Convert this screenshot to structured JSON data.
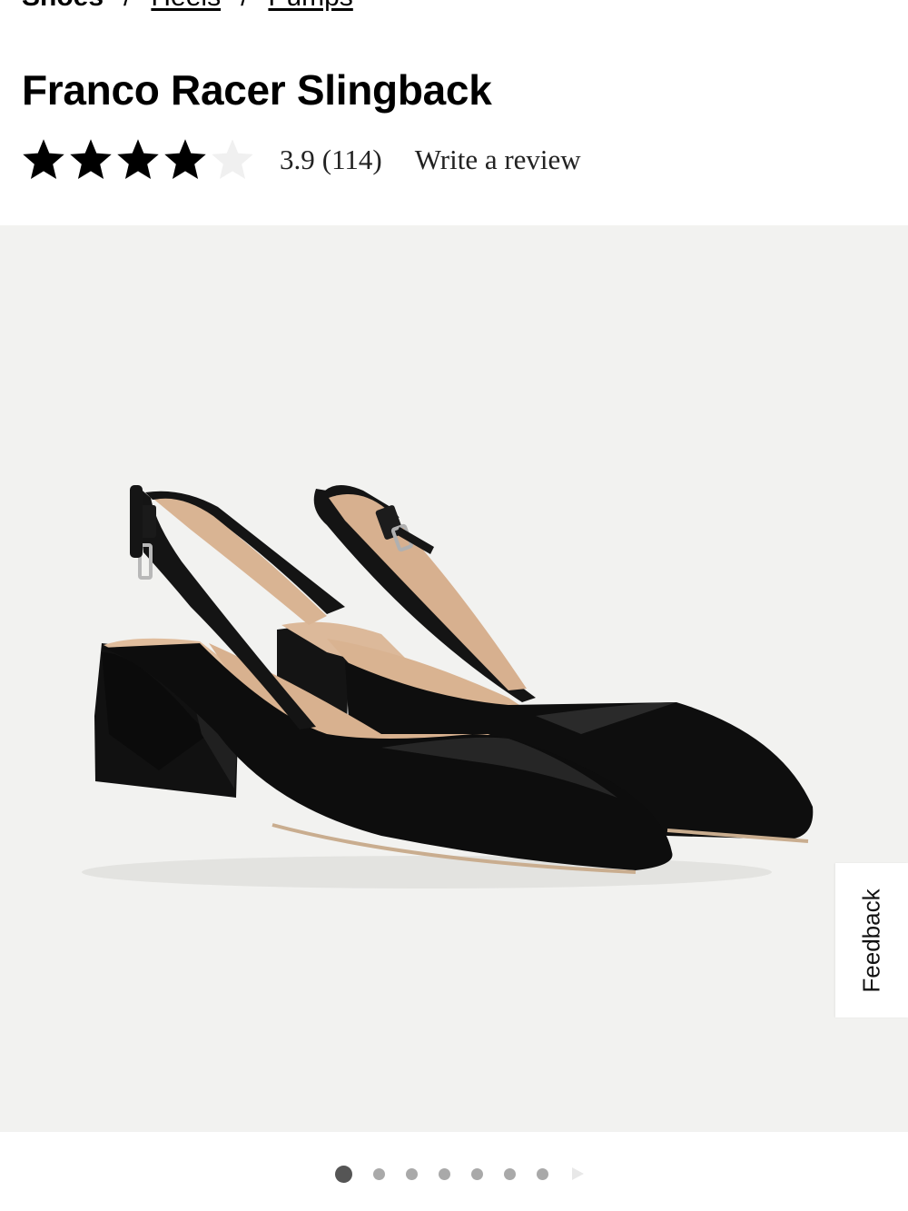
{
  "breadcrumb": {
    "current": "Shoes",
    "separator": "/",
    "link1": "Heels",
    "link2": "Pumps"
  },
  "product": {
    "title": "Franco Racer Slingback",
    "rating": {
      "average": "3.9",
      "count": "(114)",
      "stars_filled": 4,
      "stars_total": 5
    },
    "write_review_label": "Write a review"
  },
  "gallery": {
    "image_alt": "Franco Racer Slingback black pointed-toe slingback heels",
    "background_color": "#f2f2f0",
    "total_images": 7,
    "active_index": 0
  },
  "feedback": {
    "label": "Feedback"
  },
  "colors": {
    "star_filled": "#000000",
    "star_empty": "#f0f0f0",
    "dot_active": "#555555",
    "dot_inactive": "#a9a9a9"
  }
}
